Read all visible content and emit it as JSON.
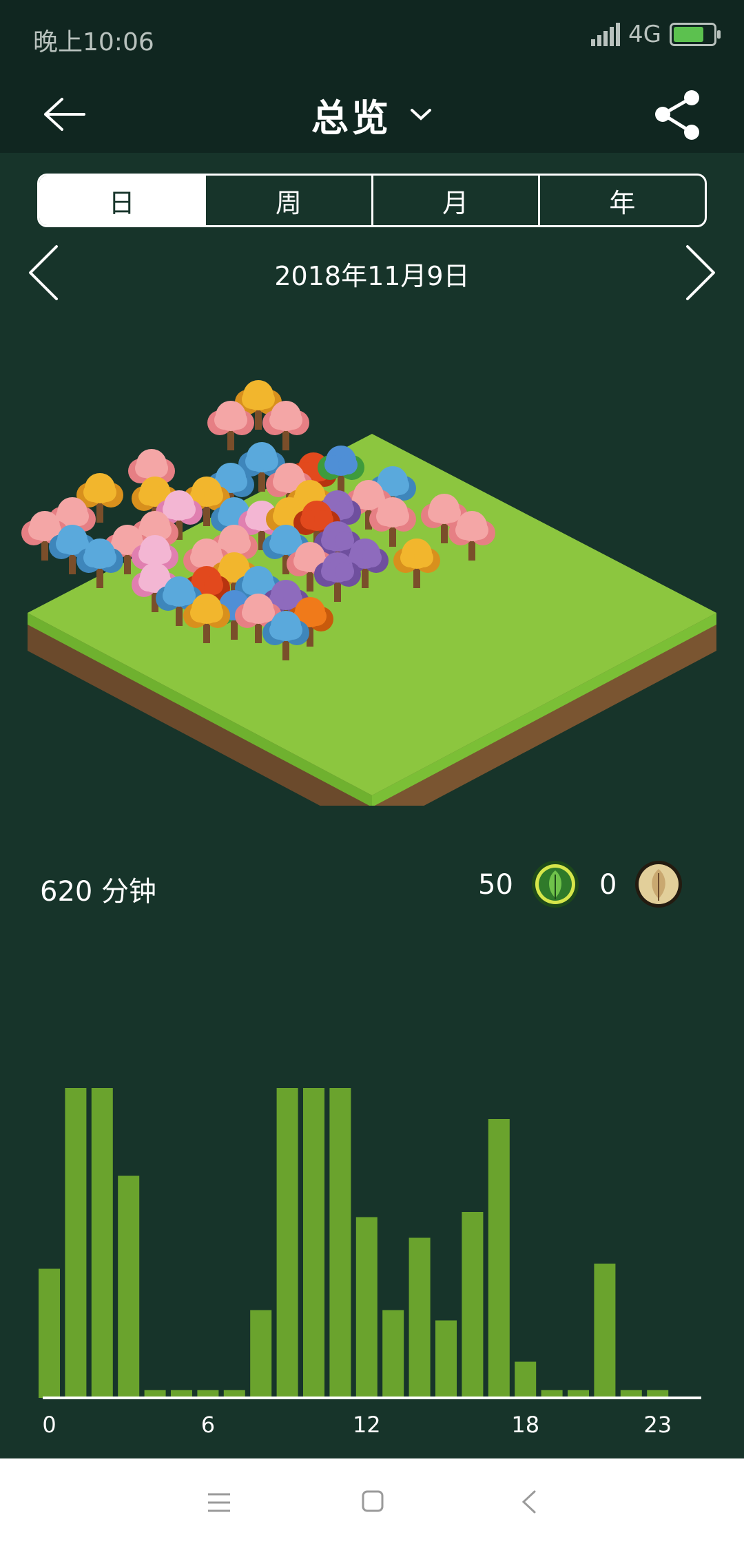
{
  "status_bar": {
    "time": "晚上10:06",
    "network": "4G",
    "battery_level": 0.7
  },
  "header": {
    "title": "总览"
  },
  "tabs": [
    {
      "label": "日",
      "active": true
    },
    {
      "label": "周",
      "active": false
    },
    {
      "label": "月",
      "active": false
    },
    {
      "label": "年",
      "active": false
    }
  ],
  "date": "2018年11月9日",
  "summary": {
    "minutes": "620 分钟",
    "trees_alive": "50",
    "trees_dead": "0"
  },
  "colors": {
    "background": "#17342a",
    "header": "#102620",
    "bar": "#6aa32d",
    "grass": "#8cc63f"
  },
  "chart_data": {
    "type": "bar",
    "categories": [
      "0",
      "1",
      "2",
      "3",
      "4",
      "5",
      "6",
      "7",
      "8",
      "9",
      "10",
      "11",
      "12",
      "13",
      "14",
      "15",
      "16",
      "17",
      "18",
      "19",
      "20",
      "21",
      "22",
      "23"
    ],
    "values": [
      25,
      60,
      60,
      43,
      1.5,
      1.5,
      1.5,
      1.5,
      17,
      60,
      60,
      60,
      35,
      17,
      31,
      15,
      36,
      54,
      7,
      1.5,
      1.5,
      26,
      1.5,
      1.5
    ],
    "ylim": [
      0,
      80
    ],
    "x_tick_labels": [
      "0",
      "6",
      "12",
      "18",
      "23"
    ],
    "grid": false
  }
}
